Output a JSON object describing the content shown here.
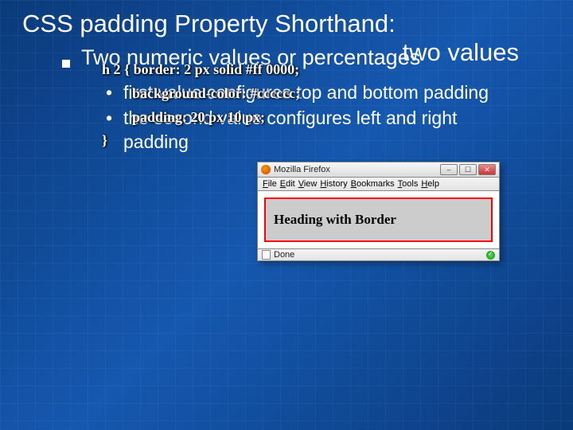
{
  "title": {
    "line1": "CSS padding Property Shorthand:",
    "line2": "two values"
  },
  "bullet1": "Two numeric values or percentages",
  "sub1": "first value configures top and bottom padding",
  "sub2": "the second value configures left and right padding",
  "browser": {
    "app": "Mozilla Firefox",
    "menu": {
      "file": "File",
      "edit": "Edit",
      "view": "View",
      "history": "History",
      "bookmarks": "Bookmarks",
      "tools": "Tools",
      "help": "Help"
    },
    "heading": "Heading with Border",
    "status": "Done"
  },
  "code": {
    "l1": "h 2 { border: 2 px solid #ff 0000;",
    "l2": "background-color: #cccccc;",
    "l3": "padding: 20 px 10 px;",
    "l4": "}"
  }
}
